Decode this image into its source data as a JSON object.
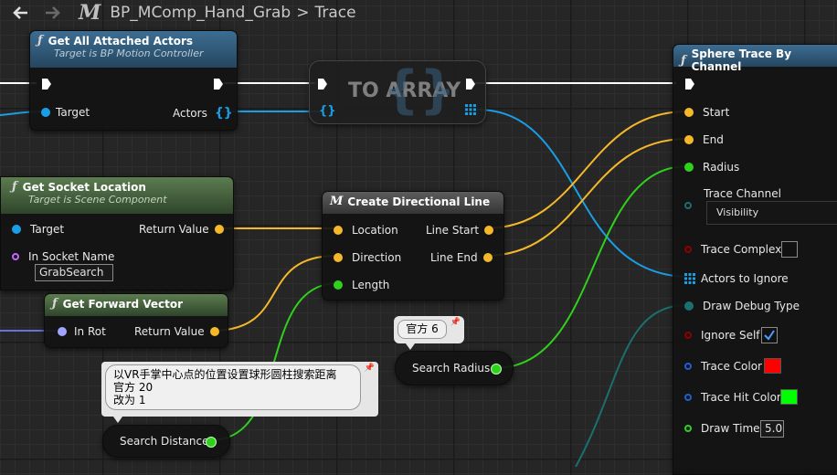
{
  "header": {
    "blueprint_icon": "M",
    "path": "BP_MComp_Hand_Grab",
    "separator": ">",
    "graph": "Trace"
  },
  "nodes": {
    "get_attached": {
      "title": "Get All Attached Actors",
      "subtitle": "Target is BP Motion Controller",
      "pin_target": "Target",
      "pin_actors": "Actors"
    },
    "to_array": {
      "title": "TO ARRAY"
    },
    "get_socket": {
      "title": "Get Socket Location",
      "subtitle": "Target is Scene Component",
      "pin_target": "Target",
      "pin_return": "Return Value",
      "pin_socket_name": "In Socket Name",
      "socket_value": "GrabSearch"
    },
    "forward_vector": {
      "title": "Get Forward Vector",
      "pin_rot": "In Rot",
      "pin_return": "Return Value"
    },
    "directional_line": {
      "title": "Create Directional Line",
      "pin_location": "Location",
      "pin_direction": "Direction",
      "pin_length": "Length",
      "pin_line_start": "Line Start",
      "pin_line_end": "Line End"
    },
    "search_radius": {
      "label": "Search Radius",
      "comment": "官方 6"
    },
    "search_distance": {
      "label": "Search Distance",
      "comment_line1": "以VR手掌中心点的位置设置球形圆柱搜索距离",
      "comment_line2": "官方 20",
      "comment_line3": "改为 1"
    },
    "sphere_trace": {
      "title": "Sphere Trace By Channel",
      "pin_start": "Start",
      "pin_end": "End",
      "pin_radius": "Radius",
      "pin_trace_channel": "Trace Channel",
      "trace_channel_value": "Visibility",
      "pin_trace_complex": "Trace Complex",
      "pin_actors_ignore": "Actors to Ignore",
      "pin_draw_debug": "Draw Debug Type",
      "pin_ignore_self": "Ignore Self",
      "pin_trace_color": "Trace Color",
      "pin_trace_hit_color": "Trace Hit Color",
      "pin_draw_time": "Draw Time",
      "draw_time_value": "5.0",
      "trace_complex_checked": false,
      "ignore_self_checked": true,
      "trace_color": "#ff0000",
      "trace_hit_color": "#00ff00"
    }
  },
  "colors": {
    "vector_pin": "#f4b82a",
    "float_pin": "#2fd11d",
    "object_pin": "#1a9ee6",
    "name_pin": "#c566ff",
    "rotator_pin": "#a0a6ff",
    "channel_pin": "#1c6f6f",
    "bool_pin": "#8c0000",
    "struct_pin": "#1e5fd1",
    "exec_wire": "#ffffff"
  }
}
